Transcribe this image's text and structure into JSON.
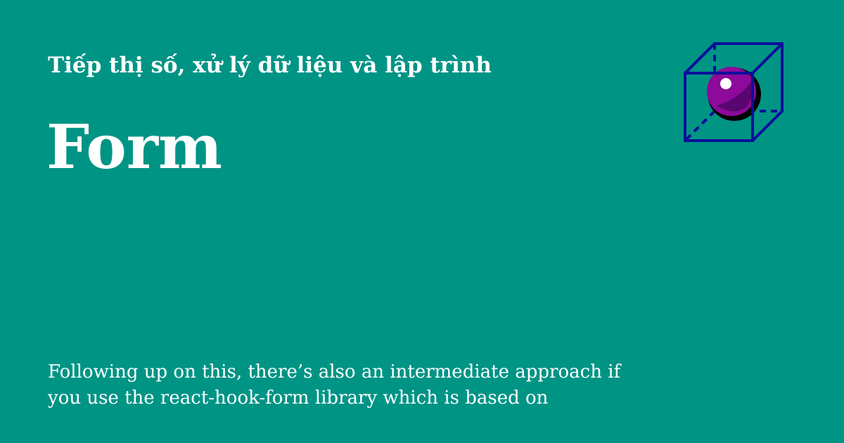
{
  "header": {
    "site_title": "Tiếp thị số, xử lý dữ liệu và lập trình"
  },
  "main": {
    "title": "Form",
    "excerpt": "Following up on this, there’s also an intermediate approach if you use the react-hook-form library which is based on"
  },
  "logo": {
    "icon": "cube-sphere-icon",
    "cube_color": "#0a0f9c",
    "sphere_color": "#8e0a9a",
    "sphere_shadow_color": "#5a0670",
    "highlight_color": "#ffffff"
  },
  "colors": {
    "background": "#009485",
    "text": "#ffffff"
  }
}
